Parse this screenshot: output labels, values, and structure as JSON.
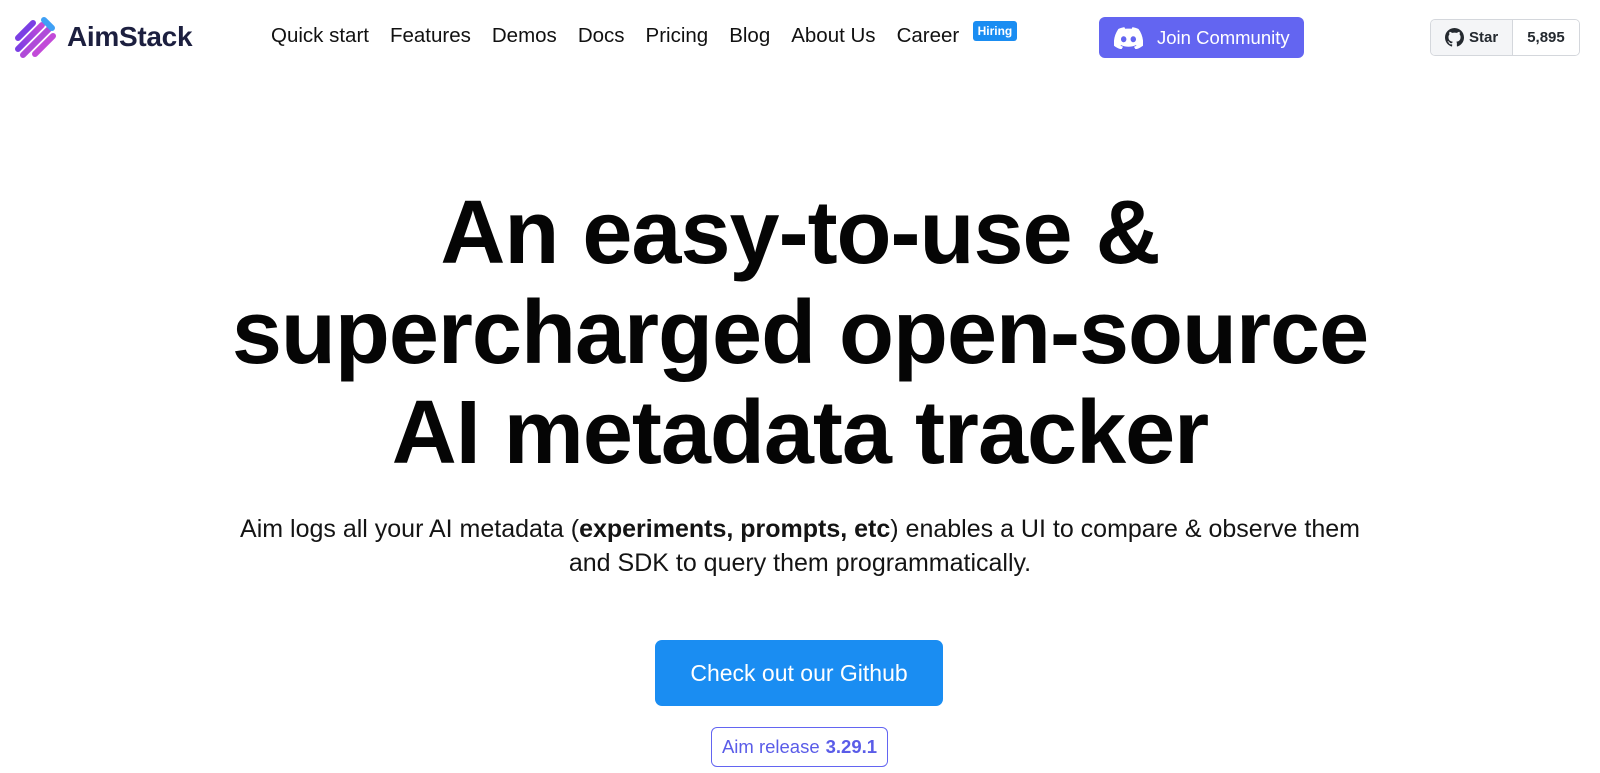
{
  "brand": {
    "name": "AimStack",
    "logo_icon": "aimstack-logo-icon",
    "logo_colors": [
      "#1c1f3f",
      "#7b3fe4",
      "#c24ad8",
      "#3fa0f5"
    ]
  },
  "nav": {
    "items": [
      {
        "label": "Quick start"
      },
      {
        "label": "Features"
      },
      {
        "label": "Demos"
      },
      {
        "label": "Docs"
      },
      {
        "label": "Pricing"
      },
      {
        "label": "Blog"
      },
      {
        "label": "About Us"
      },
      {
        "label": "Career",
        "badge": "Hiring"
      }
    ]
  },
  "community": {
    "label": "Join Community",
    "icon": "discord-icon",
    "color": "#6365f1"
  },
  "github": {
    "star_label": "Star",
    "star_count": "5,895",
    "icon": "github-icon"
  },
  "hero": {
    "title_lines": [
      "An easy-to-use &",
      "supercharged open-source",
      "AI metadata tracker"
    ],
    "subtitle": {
      "prefix": "Aim logs all your AI metadata (",
      "bold": "experiments, prompts, etc",
      "suffix": ") enables a UI to compare & observe them",
      "line2": "and SDK to query them programmatically."
    },
    "cta_label": "Check out our Github",
    "cta_color": "#1a8df2",
    "release": {
      "prefix": "Aim release",
      "version": "3.29.1"
    }
  }
}
